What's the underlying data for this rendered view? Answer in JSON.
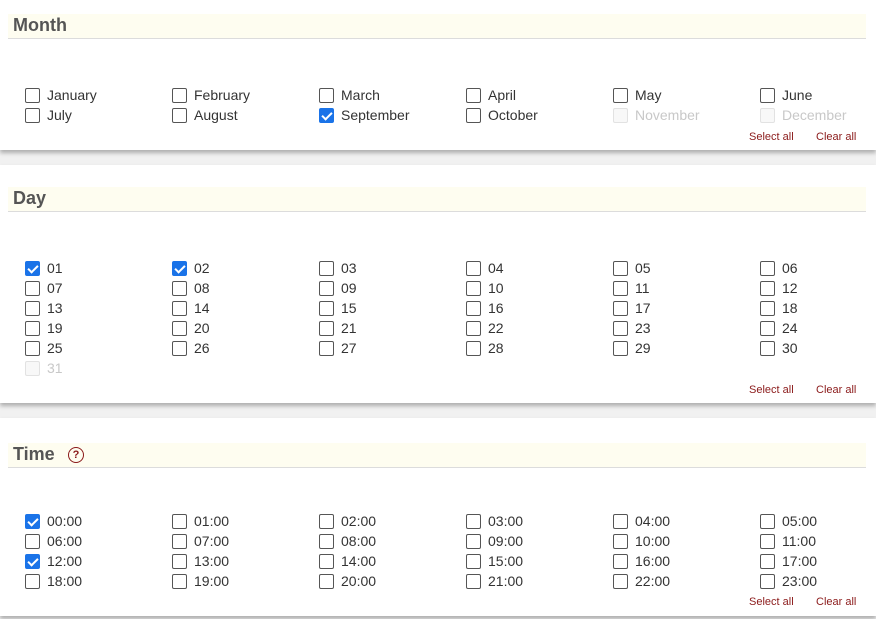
{
  "actions": {
    "select_all": "Select all",
    "clear_all": "Clear all"
  },
  "sections": [
    {
      "key": "month",
      "title": "Month",
      "help": false,
      "options": [
        {
          "label": "January",
          "checked": false,
          "disabled": false
        },
        {
          "label": "February",
          "checked": false,
          "disabled": false
        },
        {
          "label": "March",
          "checked": false,
          "disabled": false
        },
        {
          "label": "April",
          "checked": false,
          "disabled": false
        },
        {
          "label": "May",
          "checked": false,
          "disabled": false
        },
        {
          "label": "June",
          "checked": false,
          "disabled": false
        },
        {
          "label": "July",
          "checked": false,
          "disabled": false
        },
        {
          "label": "August",
          "checked": false,
          "disabled": false
        },
        {
          "label": "September",
          "checked": true,
          "disabled": false
        },
        {
          "label": "October",
          "checked": false,
          "disabled": false
        },
        {
          "label": "November",
          "checked": false,
          "disabled": true
        },
        {
          "label": "December",
          "checked": false,
          "disabled": true
        }
      ]
    },
    {
      "key": "day",
      "title": "Day",
      "help": false,
      "options": [
        {
          "label": "01",
          "checked": true,
          "disabled": false
        },
        {
          "label": "02",
          "checked": true,
          "disabled": false
        },
        {
          "label": "03",
          "checked": false,
          "disabled": false
        },
        {
          "label": "04",
          "checked": false,
          "disabled": false
        },
        {
          "label": "05",
          "checked": false,
          "disabled": false
        },
        {
          "label": "06",
          "checked": false,
          "disabled": false
        },
        {
          "label": "07",
          "checked": false,
          "disabled": false
        },
        {
          "label": "08",
          "checked": false,
          "disabled": false
        },
        {
          "label": "09",
          "checked": false,
          "disabled": false
        },
        {
          "label": "10",
          "checked": false,
          "disabled": false
        },
        {
          "label": "11",
          "checked": false,
          "disabled": false
        },
        {
          "label": "12",
          "checked": false,
          "disabled": false
        },
        {
          "label": "13",
          "checked": false,
          "disabled": false
        },
        {
          "label": "14",
          "checked": false,
          "disabled": false
        },
        {
          "label": "15",
          "checked": false,
          "disabled": false
        },
        {
          "label": "16",
          "checked": false,
          "disabled": false
        },
        {
          "label": "17",
          "checked": false,
          "disabled": false
        },
        {
          "label": "18",
          "checked": false,
          "disabled": false
        },
        {
          "label": "19",
          "checked": false,
          "disabled": false
        },
        {
          "label": "20",
          "checked": false,
          "disabled": false
        },
        {
          "label": "21",
          "checked": false,
          "disabled": false
        },
        {
          "label": "22",
          "checked": false,
          "disabled": false
        },
        {
          "label": "23",
          "checked": false,
          "disabled": false
        },
        {
          "label": "24",
          "checked": false,
          "disabled": false
        },
        {
          "label": "25",
          "checked": false,
          "disabled": false
        },
        {
          "label": "26",
          "checked": false,
          "disabled": false
        },
        {
          "label": "27",
          "checked": false,
          "disabled": false
        },
        {
          "label": "28",
          "checked": false,
          "disabled": false
        },
        {
          "label": "29",
          "checked": false,
          "disabled": false
        },
        {
          "label": "30",
          "checked": false,
          "disabled": false
        },
        {
          "label": "31",
          "checked": false,
          "disabled": true
        }
      ]
    },
    {
      "key": "time",
      "title": "Time",
      "help": true,
      "help_icon": "help-question-icon",
      "help_glyph": "?",
      "options": [
        {
          "label": "00:00",
          "checked": true,
          "disabled": false
        },
        {
          "label": "01:00",
          "checked": false,
          "disabled": false
        },
        {
          "label": "02:00",
          "checked": false,
          "disabled": false
        },
        {
          "label": "03:00",
          "checked": false,
          "disabled": false
        },
        {
          "label": "04:00",
          "checked": false,
          "disabled": false
        },
        {
          "label": "05:00",
          "checked": false,
          "disabled": false
        },
        {
          "label": "06:00",
          "checked": false,
          "disabled": false
        },
        {
          "label": "07:00",
          "checked": false,
          "disabled": false
        },
        {
          "label": "08:00",
          "checked": false,
          "disabled": false
        },
        {
          "label": "09:00",
          "checked": false,
          "disabled": false
        },
        {
          "label": "10:00",
          "checked": false,
          "disabled": false
        },
        {
          "label": "11:00",
          "checked": false,
          "disabled": false
        },
        {
          "label": "12:00",
          "checked": true,
          "disabled": false
        },
        {
          "label": "13:00",
          "checked": false,
          "disabled": false
        },
        {
          "label": "14:00",
          "checked": false,
          "disabled": false
        },
        {
          "label": "15:00",
          "checked": false,
          "disabled": false
        },
        {
          "label": "16:00",
          "checked": false,
          "disabled": false
        },
        {
          "label": "17:00",
          "checked": false,
          "disabled": false
        },
        {
          "label": "18:00",
          "checked": false,
          "disabled": false
        },
        {
          "label": "19:00",
          "checked": false,
          "disabled": false
        },
        {
          "label": "20:00",
          "checked": false,
          "disabled": false
        },
        {
          "label": "21:00",
          "checked": false,
          "disabled": false
        },
        {
          "label": "22:00",
          "checked": false,
          "disabled": false
        },
        {
          "label": "23:00",
          "checked": false,
          "disabled": false
        }
      ]
    }
  ]
}
